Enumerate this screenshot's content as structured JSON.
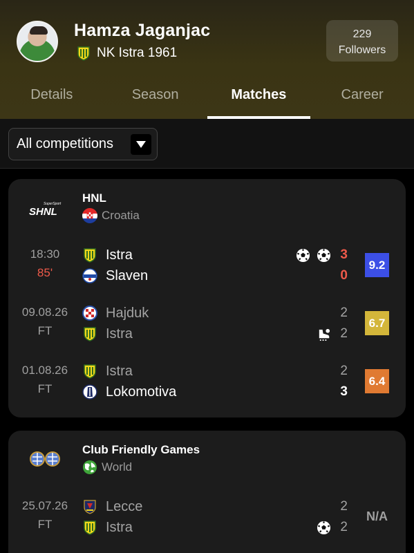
{
  "player": {
    "name": "Hamza Jaganjac",
    "team": "NK Istra 1961",
    "followers_count": "229",
    "followers_label": "Followers"
  },
  "tabs": [
    {
      "label": "Details"
    },
    {
      "label": "Season"
    },
    {
      "label": "Matches",
      "active": true
    },
    {
      "label": "Career"
    }
  ],
  "filter": {
    "selected": "All competitions"
  },
  "competitions": [
    {
      "logo_text": "SHNL",
      "logo_small": "SuperSport",
      "name": "HNL",
      "country": "Croatia",
      "matches": [
        {
          "time": "18:30",
          "status": "85'",
          "home": "Istra",
          "away": "Slaven",
          "home_score": "3",
          "away_score": "0",
          "rating": "9.2",
          "rating_color": "#3c4fe6"
        },
        {
          "time": "09.08.26",
          "status": "FT",
          "home": "Hajduk",
          "away": "Istra",
          "home_score": "2",
          "away_score": "2",
          "rating": "6.7",
          "rating_color": "#d3b63a"
        },
        {
          "time": "01.08.26",
          "status": "FT",
          "home": "Istra",
          "away": "Lokomotiva",
          "home_score": "2",
          "away_score": "3",
          "rating": "6.4",
          "rating_color": "#e07a32"
        }
      ]
    },
    {
      "name": "Club Friendly Games",
      "country": "World",
      "matches": [
        {
          "time": "25.07.26",
          "status": "FT",
          "home": "Lecce",
          "away": "Istra",
          "home_score": "2",
          "away_score": "2",
          "rating": "N/A"
        }
      ]
    }
  ],
  "colors": {
    "live": "#ef5a4a",
    "card_bg": "#1c1c1c",
    "header_bg": "#3a3414"
  }
}
